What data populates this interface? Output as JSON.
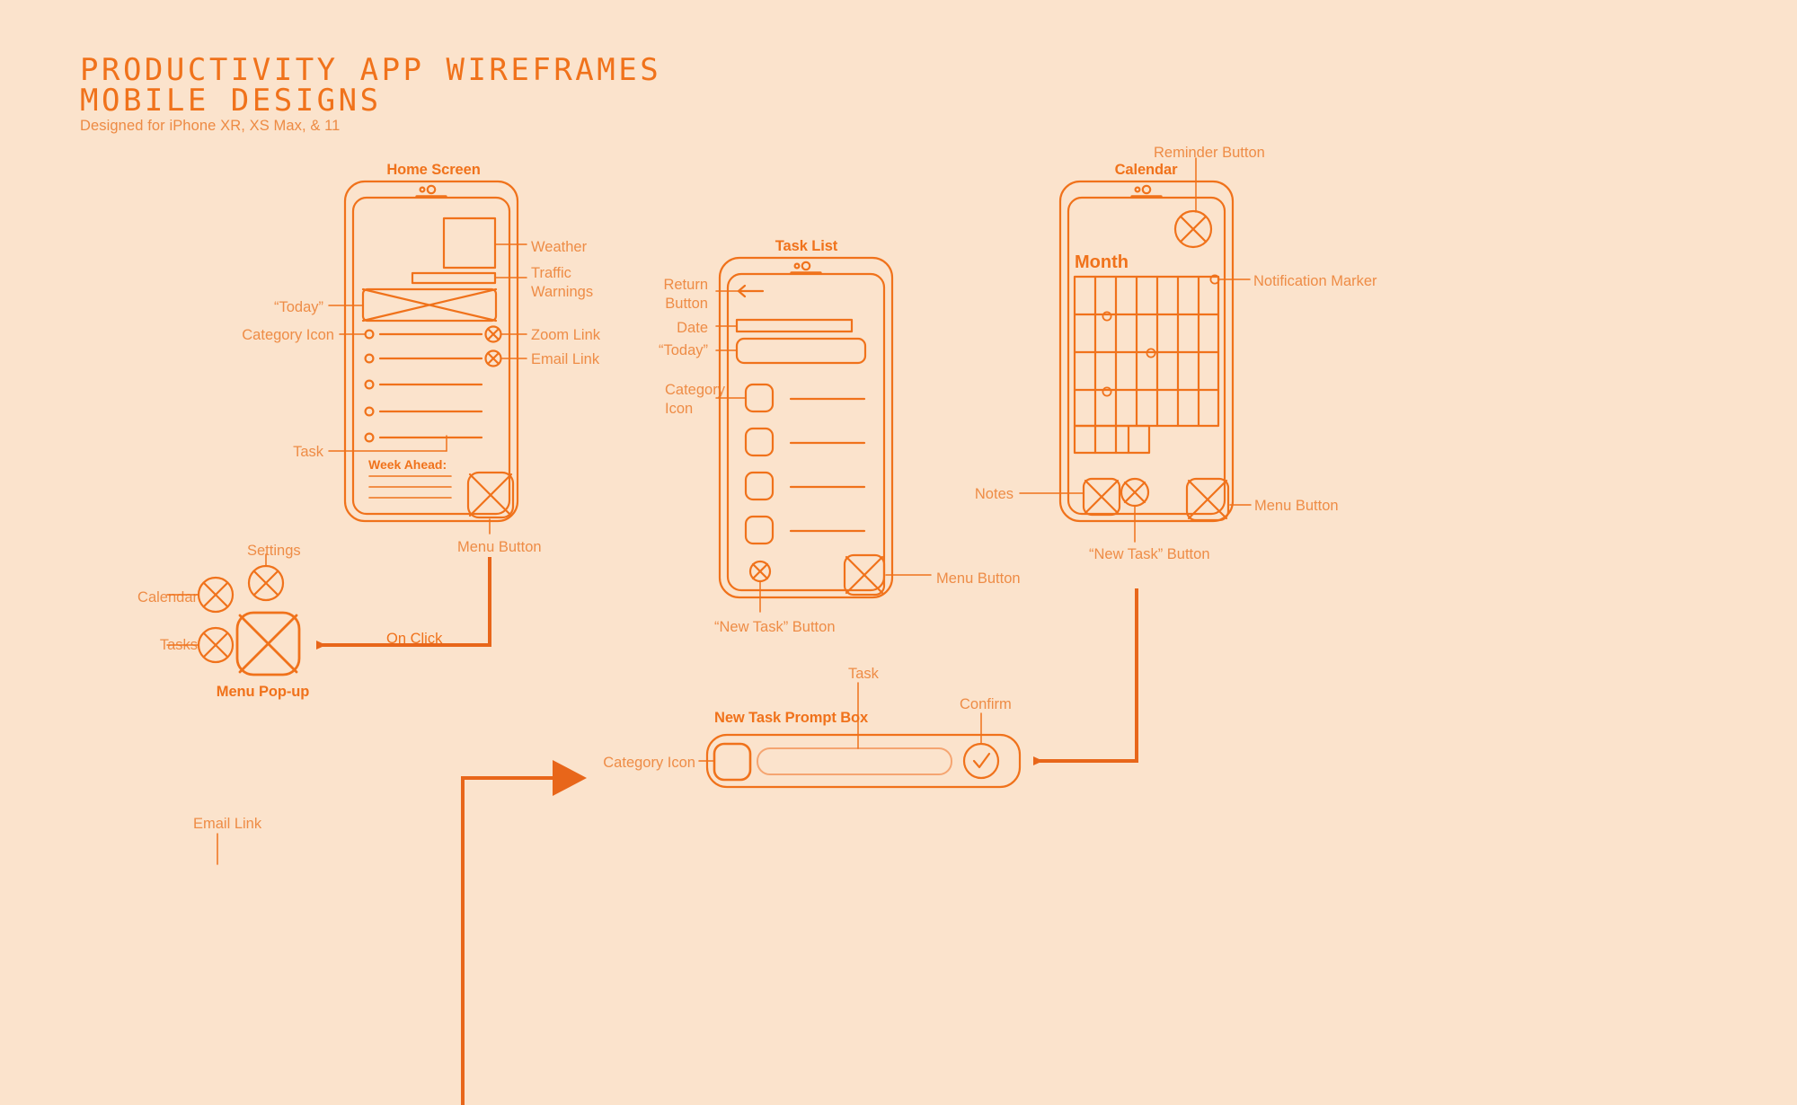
{
  "header": {
    "title_line1": "PRODUCTIVITY APP WIREFRAMES",
    "title_line2": "MOBILE DESIGNS",
    "subtitle": "Designed for iPhone XR, XS Max, & 11"
  },
  "colors": {
    "background": "#FBE3CC",
    "stroke": "#F0721B",
    "stroke_light": "#F3925B",
    "text": "#EE8C46",
    "accent": "#E8661A"
  },
  "screens": {
    "home": {
      "title": "Home Screen",
      "inner_label": "Week Ahead:",
      "callouts": [
        {
          "label": "Weather"
        },
        {
          "label": "Traffic\nWarnings"
        },
        {
          "label": "“Today”"
        },
        {
          "label": "Category Icon"
        },
        {
          "label": "Zoom Link"
        },
        {
          "label": "Email Link"
        },
        {
          "label": "Task"
        },
        {
          "label": "Menu Button"
        }
      ]
    },
    "tasklist": {
      "title": "Task List",
      "callouts": [
        {
          "label": "Return\nButton"
        },
        {
          "label": "Date"
        },
        {
          "label": "“Today”"
        },
        {
          "label": "Category\nIcon"
        },
        {
          "label": "“New Task” Button"
        },
        {
          "label": "Menu Button"
        }
      ]
    },
    "calendar": {
      "title": "Calendar",
      "inner_label": "Month",
      "callouts": [
        {
          "label": "Reminder Button"
        },
        {
          "label": "Notification Marker"
        },
        {
          "label": "Notes"
        },
        {
          "label": "Menu Button"
        },
        {
          "label": "“New Task” Button"
        }
      ]
    },
    "menu_popup": {
      "title": "Menu Pop-up",
      "callouts": [
        {
          "label": "Settings"
        },
        {
          "label": "Calendar"
        },
        {
          "label": "Tasks"
        }
      ]
    },
    "prompt_box": {
      "title": "New Task Prompt Box",
      "callouts": [
        {
          "label": "Task"
        },
        {
          "label": "Confirm"
        },
        {
          "label": "Category Icon"
        }
      ]
    },
    "bottom": {
      "callouts": [
        {
          "label": "Email Link"
        }
      ]
    }
  },
  "flow": {
    "on_click_label": "On Click"
  },
  "chart_data": {
    "type": "table",
    "title": "Productivity App Wireframes - Mobile Designs",
    "notes": "Annotated wireframe flow diagram of four mobile screens"
  }
}
